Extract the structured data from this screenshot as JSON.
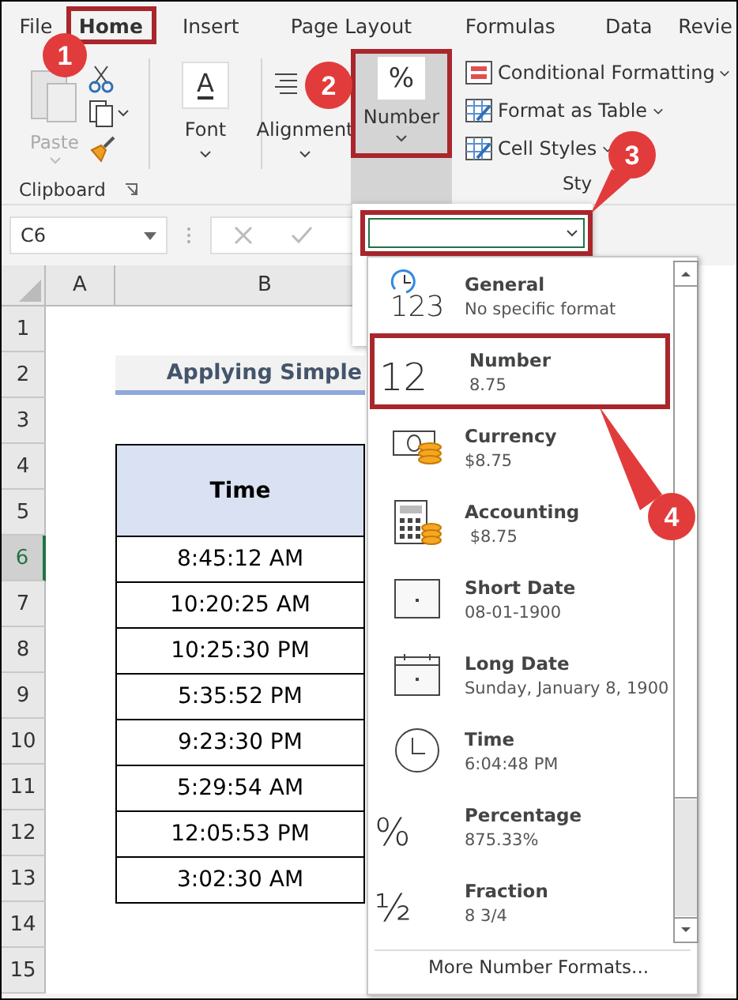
{
  "ribbon_tabs": [
    {
      "label": "File",
      "selected": false
    },
    {
      "label": "Home",
      "selected": true
    },
    {
      "label": "Insert",
      "selected": false
    },
    {
      "label": "Page Layout",
      "selected": false
    },
    {
      "label": "Formulas",
      "selected": false
    },
    {
      "label": "Data",
      "selected": false
    },
    {
      "label": "Revie",
      "selected": false
    }
  ],
  "ribbon": {
    "paste": "Paste",
    "clipboard_group": "Clipboard",
    "font_glyph": "A",
    "font": "Font",
    "alignment": "Alignment",
    "number_glyph": "%",
    "number": "Number",
    "styles": [
      "Conditional Formatting",
      "Format as Table",
      "Cell Styles"
    ],
    "styles_group": "Sty"
  },
  "formula_bar": {
    "name_box": "C6"
  },
  "columns": [
    "A",
    "B"
  ],
  "rows": [
    {
      "label": "1",
      "selected": false
    },
    {
      "label": "2",
      "selected": false
    },
    {
      "label": "3",
      "selected": false
    },
    {
      "label": "4",
      "selected": false
    },
    {
      "label": "5",
      "selected": false
    },
    {
      "label": "6",
      "selected": true
    },
    {
      "label": "7",
      "selected": false
    },
    {
      "label": "8",
      "selected": false
    },
    {
      "label": "9",
      "selected": false
    },
    {
      "label": "10",
      "selected": false
    },
    {
      "label": "11",
      "selected": false
    },
    {
      "label": "12",
      "selected": false
    },
    {
      "label": "13",
      "selected": false
    },
    {
      "label": "14",
      "selected": false
    },
    {
      "label": "15",
      "selected": false
    }
  ],
  "sheet": {
    "title": "Applying Simple",
    "header": "Time",
    "times": [
      "8:45:12 AM",
      "10:20:25 AM",
      "10:25:30 PM",
      "5:35:52 PM",
      "9:23:30 PM",
      "5:29:54 AM",
      "12:05:53 PM",
      "3:02:30 AM"
    ]
  },
  "formats": [
    {
      "kind": "general",
      "glyph": "123",
      "name": "General",
      "example": "No specific format",
      "selected": false
    },
    {
      "kind": "number",
      "glyph": "12",
      "name": "Number",
      "example": "8.75",
      "selected": true
    },
    {
      "kind": "currency",
      "name": "Currency",
      "example": "$8.75",
      "selected": false
    },
    {
      "kind": "accounting",
      "name": "Accounting",
      "example": " $8.75",
      "selected": false
    },
    {
      "kind": "short_date",
      "name": "Short Date",
      "example": "08-01-1900",
      "selected": false
    },
    {
      "kind": "long_date",
      "name": "Long Date",
      "example": "Sunday, January 8, 1900",
      "selected": false
    },
    {
      "kind": "time",
      "name": "Time",
      "example": "6:04:48 PM",
      "selected": false
    },
    {
      "kind": "percentage",
      "glyph": "%",
      "name": "Percentage",
      "example": "875.33%",
      "selected": false
    },
    {
      "kind": "fraction",
      "glyph": "½",
      "name": "Fraction",
      "example": "8 3/4",
      "selected": false
    }
  ],
  "more_formats": "More Number Formats...",
  "callouts": [
    "1",
    "2",
    "3",
    "4"
  ]
}
